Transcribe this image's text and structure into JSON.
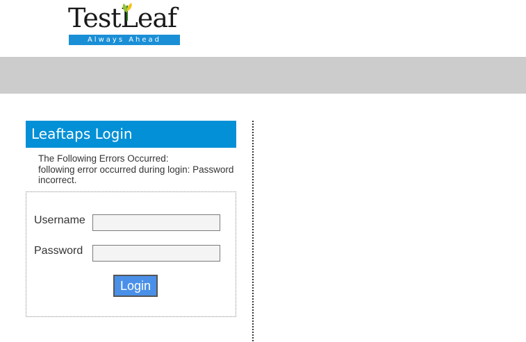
{
  "logo": {
    "name": "TestLeaf",
    "tagline": "Always Ahead"
  },
  "login": {
    "header_title": "Leaftaps Login",
    "errors_heading": "The Following Errors Occurred:",
    "error_message": "following error occurred during login: Password incorrect.",
    "username_label": "Username",
    "username_value": "",
    "password_label": "Password",
    "password_value": "",
    "submit_label": "Login"
  },
  "colors": {
    "header_blue": "#0390d6",
    "button_blue": "#4a90e8",
    "top_bar_gray": "#cccccc",
    "logo_band_blue": "#1a8fd6"
  }
}
